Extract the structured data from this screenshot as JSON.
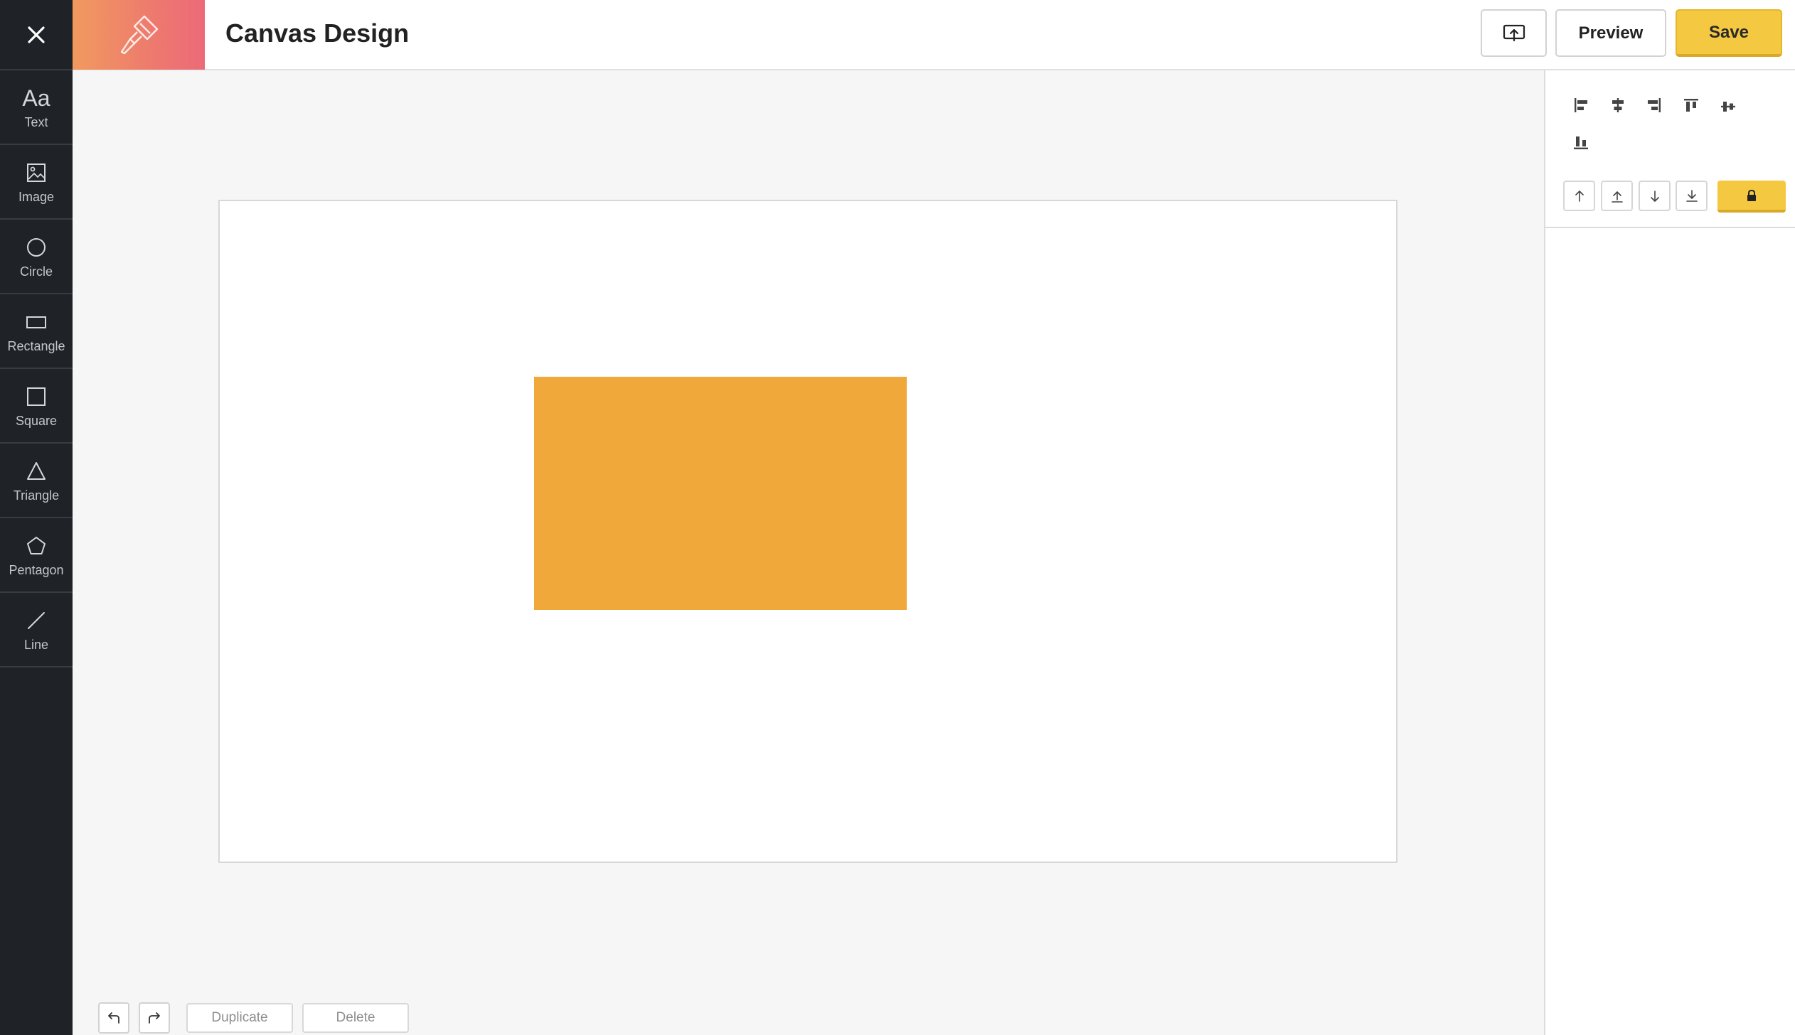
{
  "header": {
    "title": "Canvas Design",
    "preview_label": "Preview",
    "save_label": "Save"
  },
  "sidebar": {
    "tools": [
      {
        "label": "Text",
        "icon": "text-icon"
      },
      {
        "label": "Image",
        "icon": "image-icon"
      },
      {
        "label": "Circle",
        "icon": "circle-icon"
      },
      {
        "label": "Rectangle",
        "icon": "rectangle-icon"
      },
      {
        "label": "Square",
        "icon": "square-icon"
      },
      {
        "label": "Triangle",
        "icon": "triangle-icon"
      },
      {
        "label": "Pentagon",
        "icon": "pentagon-icon"
      },
      {
        "label": "Line",
        "icon": "line-icon"
      }
    ],
    "text_glyph": "Aa"
  },
  "canvas": {
    "shape_color": "#f0a83b"
  },
  "bottom_toolbar": {
    "duplicate_label": "Duplicate",
    "delete_label": "Delete"
  },
  "colors": {
    "accent": "#f5c842",
    "sidebar_bg": "#1f2226",
    "logo_gradient_start": "#f09a5e",
    "logo_gradient_end": "#ec6a78"
  }
}
